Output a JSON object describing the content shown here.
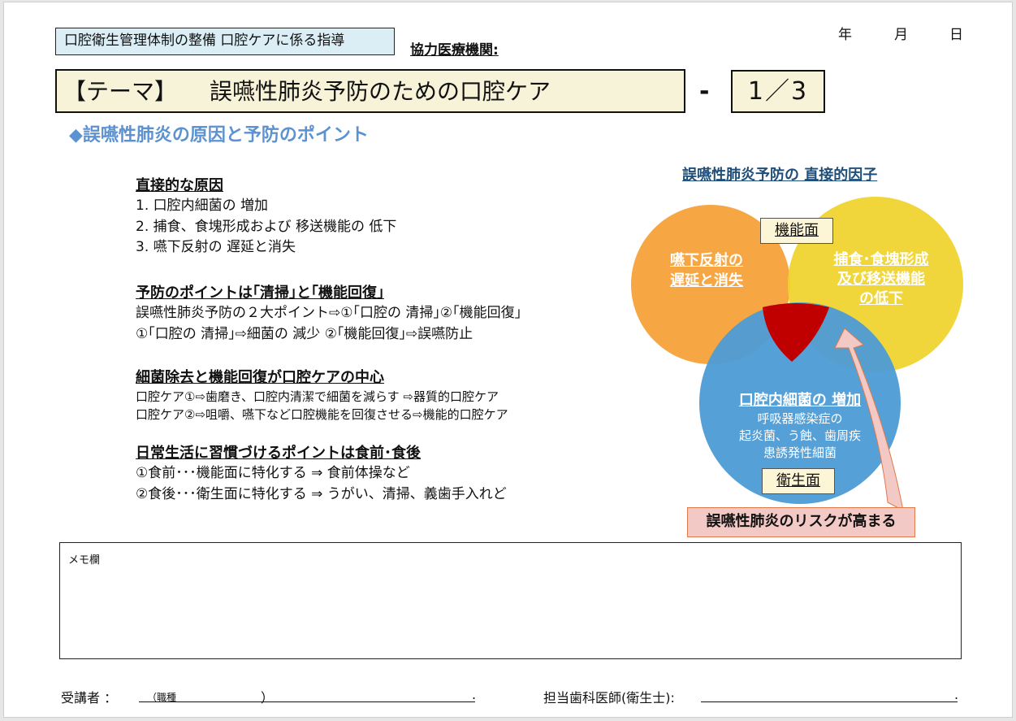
{
  "header": {
    "category": "口腔衛生管理体制の整備 口腔ケアに係る指導",
    "cooperating_institution_label": "協力医療機関:",
    "date": {
      "year": "年",
      "month": "月",
      "day": "日"
    }
  },
  "theme": {
    "label": "【テーマ】",
    "title": "誤嚥性肺炎予防のための口腔ケア",
    "dash": "-",
    "page": "1／3"
  },
  "section_title": "◆誤嚥性肺炎の原因と予防のポイント",
  "content": {
    "direct_causes": {
      "heading": "直接的な原因",
      "items": [
        "1. 口腔内細菌の 増加",
        "2. 捕食、食塊形成および 移送機能の 低下",
        "3. 嚥下反射の 遅延と消失"
      ]
    },
    "prevention": {
      "heading": "予防のポイントは｢清掃｣と｢機能回復｣",
      "lines": [
        "誤嚥性肺炎予防の２大ポイント⇨①｢口腔の 清掃｣②｢機能回復｣",
        "①｢口腔の 清掃｣⇨細菌の 減少 ②｢機能回復｣⇨誤嚥防止"
      ]
    },
    "core": {
      "heading": "細菌除去と機能回復が口腔ケアの中心",
      "lines": [
        "口腔ケア①⇨歯磨き、口腔内清潔で細菌を減らす ⇨器質的口腔ケア",
        "口腔ケア②⇨咀嚼、嚥下など口腔機能を回復させる⇨機能的口腔ケア"
      ]
    },
    "daily": {
      "heading": "日常生活に習慣づけるポイントは食前･食後",
      "lines": [
        "①食前･･･機能面に特化する ⇒ 食前体操など",
        "②食後･･･衛生面に特化する ⇒ うがい、清掃、義歯手入れど"
      ]
    }
  },
  "venn": {
    "title": "誤嚥性肺炎予防の 直接的因子",
    "function_tag": "機能面",
    "hygiene_tag": "衛生面",
    "left_circle": [
      "嚥下反射の",
      "遅延と消失"
    ],
    "right_circle": [
      "捕食･食塊形成",
      "及び移送機能",
      "の低下"
    ],
    "bottom_circle": {
      "title": "口腔内細菌の 増加",
      "lines": [
        "呼吸器感染症の",
        "起炎菌、う蝕、歯周疾",
        "患誘発性細菌"
      ]
    },
    "risk_label": "誤嚥性肺炎のリスクが高まる",
    "colors": {
      "orange": "#f6a23a",
      "yellow": "#f0d22a",
      "blue": "#4d9bd6",
      "red": "#c00000",
      "arrow": "#f2c9c4"
    }
  },
  "memo": {
    "label": "メモ欄"
  },
  "footer": {
    "attendee_label": "受講者 ：",
    "occupation_prefix": "（職種",
    "occupation_suffix": "）",
    "end_dot": ".",
    "dentist_label": "担当歯科医師(衛生士):",
    "end_dot2": "."
  }
}
